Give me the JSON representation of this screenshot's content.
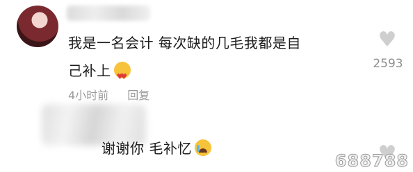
{
  "comment": {
    "text_line1": "我是一名会计 每次缺的几毛我都是自",
    "text_line2": "己补上",
    "emoji1": "heart-eyes-emoji",
    "time": "4小时前",
    "reply_label": "回复",
    "likes": "2593"
  },
  "reply": {
    "text": "谢谢你 毛补忆",
    "emoji": "crying-face-emoji"
  },
  "watermark": "688788"
}
